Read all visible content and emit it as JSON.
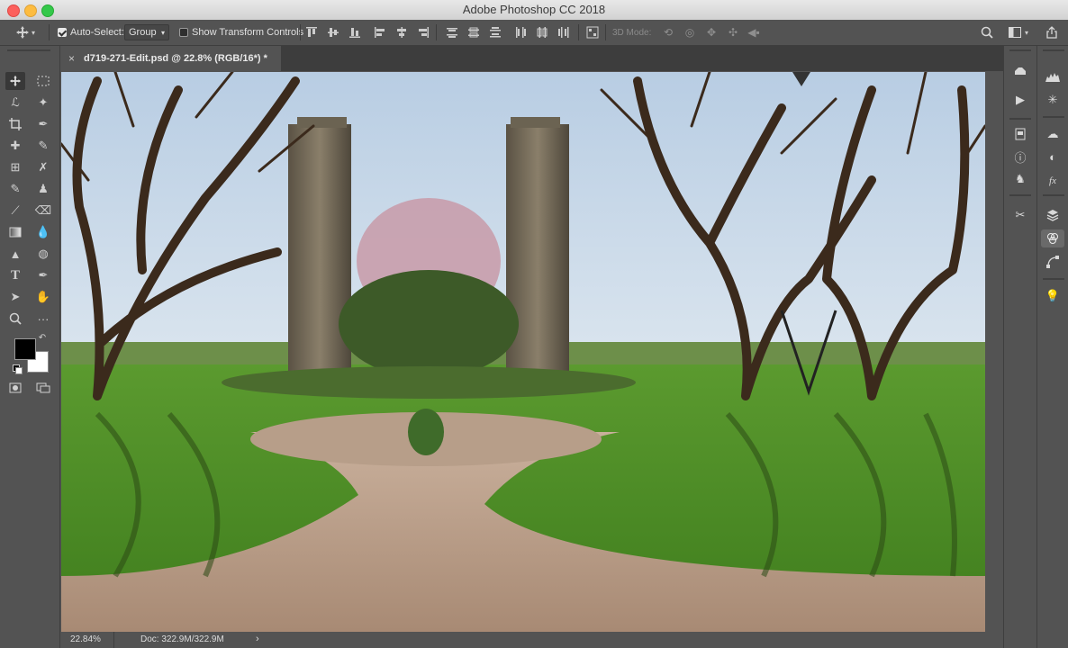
{
  "window": {
    "title": "Adobe Photoshop CC 2018"
  },
  "options_bar": {
    "auto_select_label": "Auto-Select:",
    "auto_select_checked": true,
    "auto_select_value": "Group",
    "show_transform_label": "Show Transform Controls",
    "show_transform_checked": false,
    "mode_3d_label": "3D Mode:"
  },
  "document_tab": {
    "close_glyph": "×",
    "title": "d719-271-Edit.psd @ 22.8% (RGB/16*) *"
  },
  "status": {
    "zoom": "22.84%",
    "doc": "Doc: 322.9M/322.9M",
    "arrow": "›"
  },
  "colors": {
    "foreground": "#000000",
    "background": "#ffffff"
  }
}
